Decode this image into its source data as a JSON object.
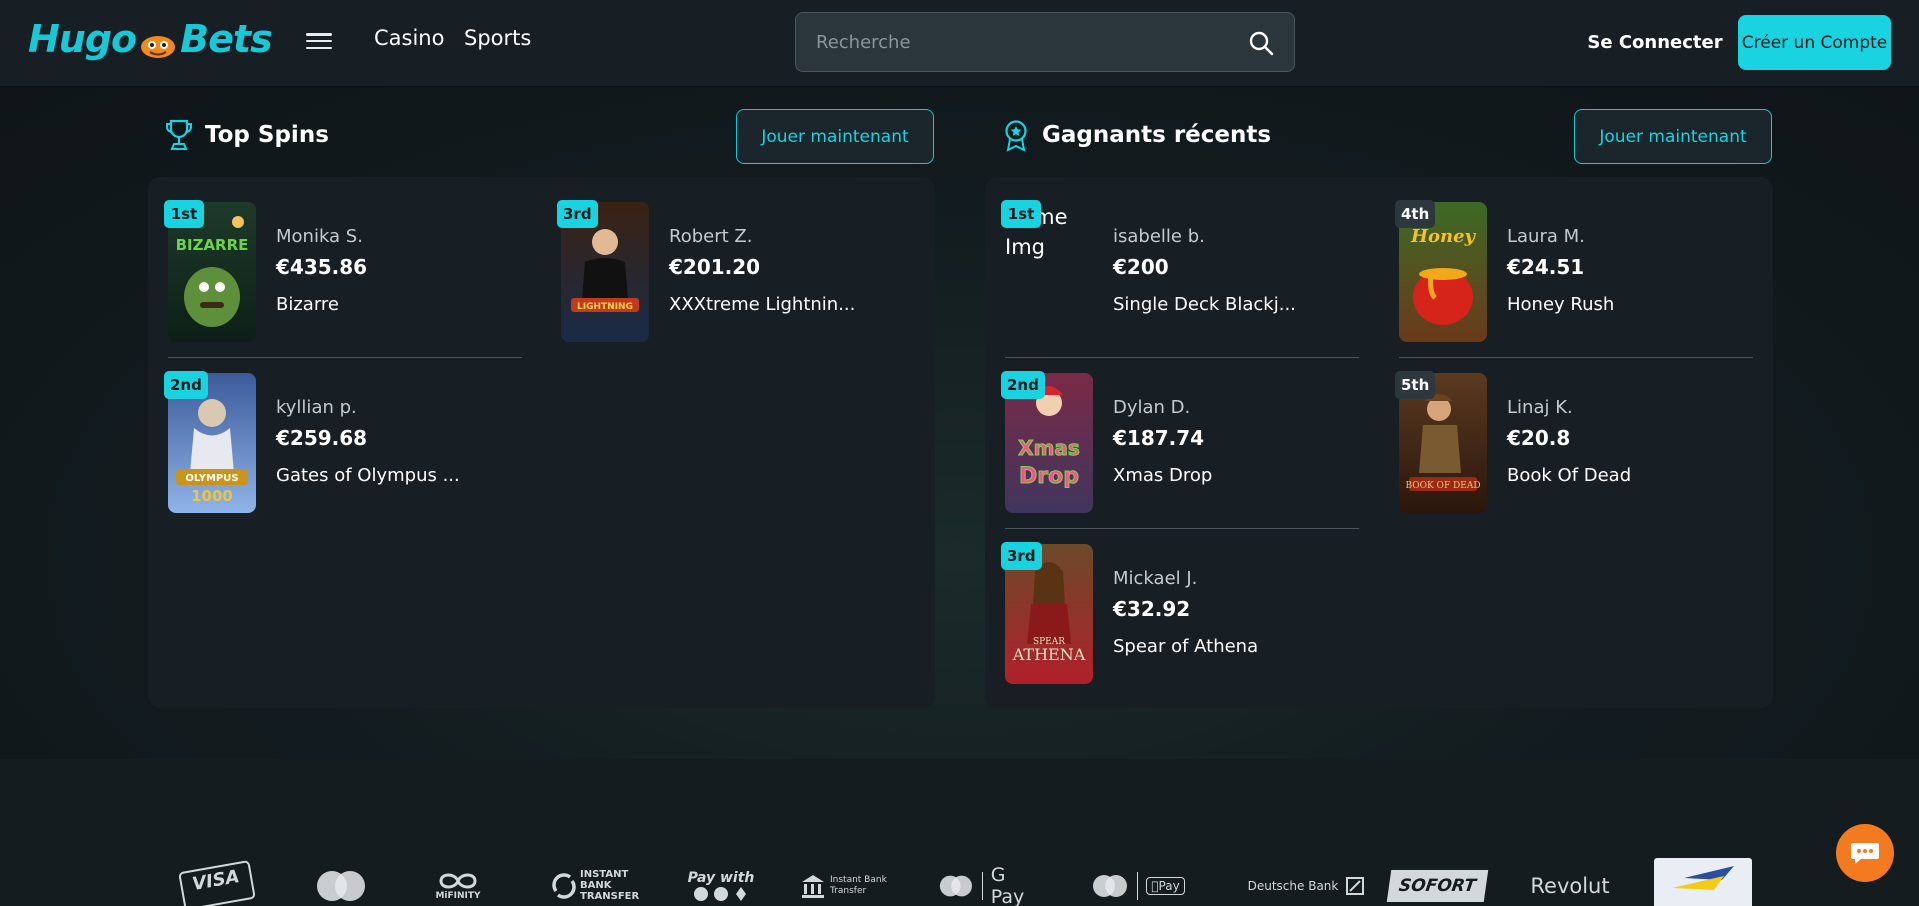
{
  "header": {
    "logo_left": "Hugo",
    "logo_right": "Bets",
    "nav": [
      "Casino",
      "Sports"
    ],
    "search_placeholder": "Recherche",
    "login_label": "Se Connecter",
    "signup_label": "Créer un Compte"
  },
  "top_spins": {
    "title": "Top Spins",
    "play_label": "Jouer maintenant",
    "entries": [
      {
        "rank": "1st",
        "name": "Monika S.",
        "amount": "€435.86",
        "game": "Bizarre"
      },
      {
        "rank": "3rd",
        "name": "Robert Z.",
        "amount": "€201.20",
        "game": "XXXtreme Lightnin..."
      },
      {
        "rank": "2nd",
        "name": "kyllian p.",
        "amount": "€259.68",
        "game": "Gates of Olympus ..."
      }
    ]
  },
  "recent_winners": {
    "title": "Gagnants récents",
    "play_label": "Jouer maintenant",
    "entries": [
      {
        "rank": "1st",
        "name": "isabelle b.",
        "amount": "€200",
        "game": "Single Deck Blackj...",
        "img_alt": "Game Img"
      },
      {
        "rank": "4th",
        "name": "Laura M.",
        "amount": "€24.51",
        "game": "Honey Rush"
      },
      {
        "rank": "2nd",
        "name": "Dylan D.",
        "amount": "€187.74",
        "game": "Xmas Drop"
      },
      {
        "rank": "5th",
        "name": "Linaj K.",
        "amount": "€20.8",
        "game": "Book Of Dead"
      },
      {
        "rank": "3rd",
        "name": "Mickael J.",
        "amount": "€32.92",
        "game": "Spear of Athena"
      }
    ]
  },
  "payments": [
    "VISA",
    "MiFINITY",
    "INSTANT BANK TRANSFER",
    "Pay with",
    "Instant Bank Transfer",
    "G Pay",
    "Pay",
    "Deutsche Bank",
    "SOFORT",
    "Revolut"
  ],
  "colors": {
    "accent": "#19d3e0",
    "background": "#0f1519",
    "panel": "#181f24",
    "chat": "#f47a1f"
  }
}
